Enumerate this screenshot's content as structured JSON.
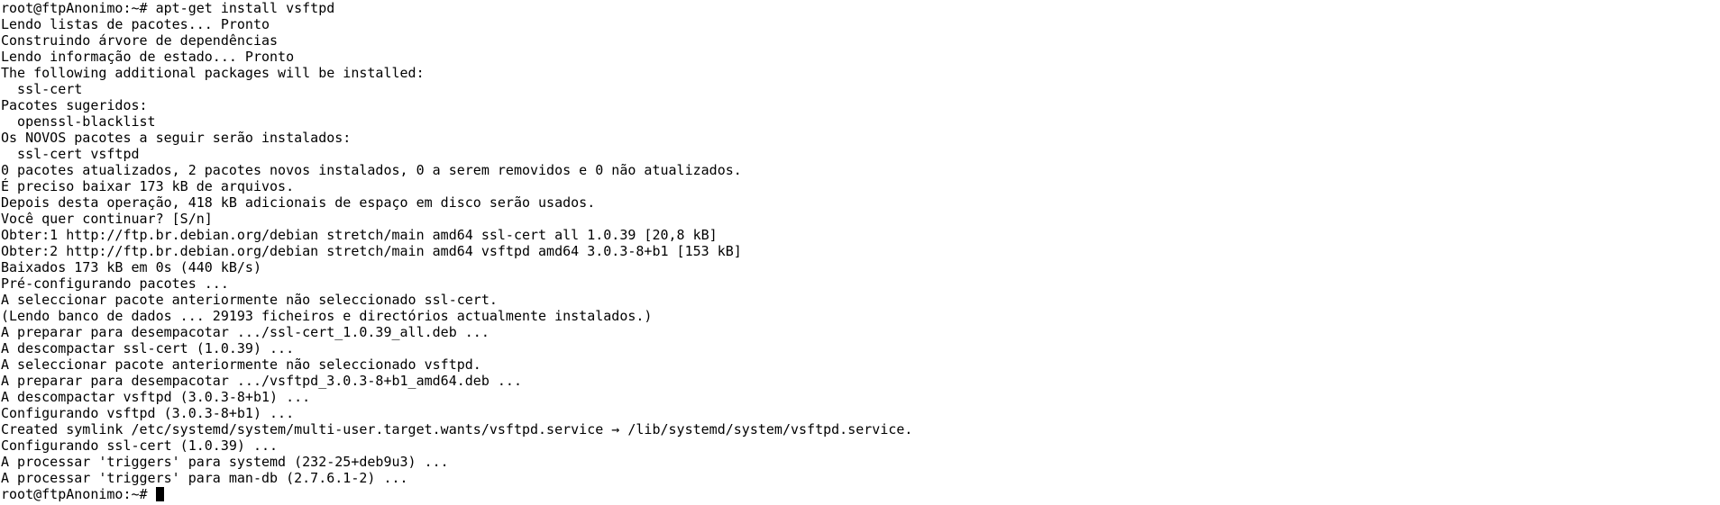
{
  "terminal": {
    "lines": [
      "root@ftpAnonimo:~# apt-get install vsftpd",
      "Lendo listas de pacotes... Pronto",
      "Construindo árvore de dependências",
      "Lendo informação de estado... Pronto",
      "The following additional packages will be installed:",
      "  ssl-cert",
      "Pacotes sugeridos:",
      "  openssl-blacklist",
      "Os NOVOS pacotes a seguir serão instalados:",
      "  ssl-cert vsftpd",
      "0 pacotes atualizados, 2 pacotes novos instalados, 0 a serem removidos e 0 não atualizados.",
      "É preciso baixar 173 kB de arquivos.",
      "Depois desta operação, 418 kB adicionais de espaço em disco serão usados.",
      "Você quer continuar? [S/n]",
      "Obter:1 http://ftp.br.debian.org/debian stretch/main amd64 ssl-cert all 1.0.39 [20,8 kB]",
      "Obter:2 http://ftp.br.debian.org/debian stretch/main amd64 vsftpd amd64 3.0.3-8+b1 [153 kB]",
      "Baixados 173 kB em 0s (440 kB/s)",
      "Pré-configurando pacotes ...",
      "A seleccionar pacote anteriormente não seleccionado ssl-cert.",
      "(Lendo banco de dados ... 29193 ficheiros e directórios actualmente instalados.)",
      "A preparar para desempacotar .../ssl-cert_1.0.39_all.deb ...",
      "A descompactar ssl-cert (1.0.39) ...",
      "A seleccionar pacote anteriormente não seleccionado vsftpd.",
      "A preparar para desempacotar .../vsftpd_3.0.3-8+b1_amd64.deb ...",
      "A descompactar vsftpd (3.0.3-8+b1) ...",
      "Configurando vsftpd (3.0.3-8+b1) ...",
      "Created symlink /etc/systemd/system/multi-user.target.wants/vsftpd.service → /lib/systemd/system/vsftpd.service.",
      "Configurando ssl-cert (1.0.39) ...",
      "A processar 'triggers' para systemd (232-25+deb9u3) ...",
      "A processar 'triggers' para man-db (2.7.6.1-2) ..."
    ],
    "prompt": "root@ftpAnonimo:~# ",
    "colors": {
      "background": "#ffffff",
      "foreground": "#000000",
      "cursor": "#000000"
    }
  }
}
